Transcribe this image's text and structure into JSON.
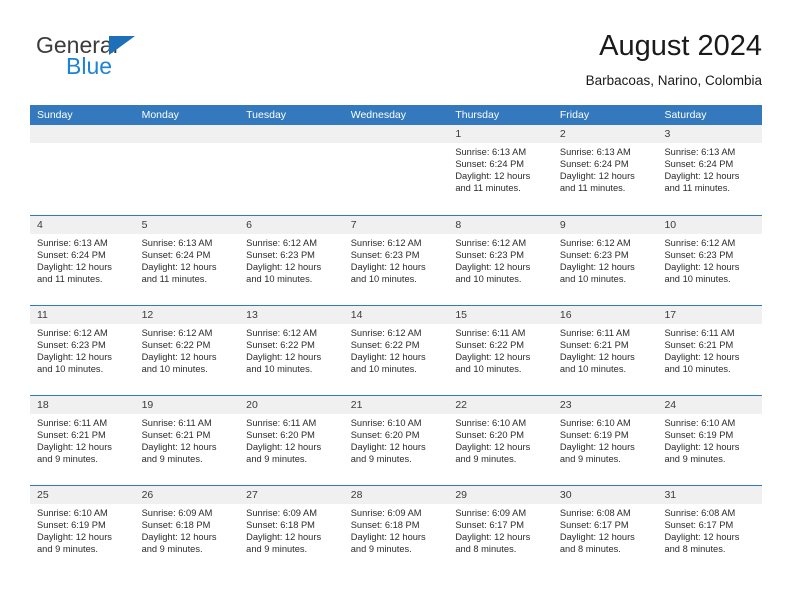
{
  "brand": {
    "name_part1": "General",
    "name_part2": "Blue",
    "triangle_icon": "triangle-icon",
    "colors": {
      "dark": "#3b3b3b",
      "blue": "#1d83d4",
      "triangle": "#1d6fb8"
    }
  },
  "header": {
    "title": "August 2024",
    "subtitle": "Barbacoas, Narino, Colombia"
  },
  "calendar": {
    "header_bg": "#3479bd",
    "header_text": "#ffffff",
    "band_bg": "#f0f0f0",
    "weekdays": [
      "Sunday",
      "Monday",
      "Tuesday",
      "Wednesday",
      "Thursday",
      "Friday",
      "Saturday"
    ],
    "weeks": [
      [
        {
          "day": "",
          "sunrise": "",
          "sunset": "",
          "daylight1": "",
          "daylight2": ""
        },
        {
          "day": "",
          "sunrise": "",
          "sunset": "",
          "daylight1": "",
          "daylight2": ""
        },
        {
          "day": "",
          "sunrise": "",
          "sunset": "",
          "daylight1": "",
          "daylight2": ""
        },
        {
          "day": "",
          "sunrise": "",
          "sunset": "",
          "daylight1": "",
          "daylight2": ""
        },
        {
          "day": "1",
          "sunrise": "Sunrise: 6:13 AM",
          "sunset": "Sunset: 6:24 PM",
          "daylight1": "Daylight: 12 hours",
          "daylight2": "and 11 minutes."
        },
        {
          "day": "2",
          "sunrise": "Sunrise: 6:13 AM",
          "sunset": "Sunset: 6:24 PM",
          "daylight1": "Daylight: 12 hours",
          "daylight2": "and 11 minutes."
        },
        {
          "day": "3",
          "sunrise": "Sunrise: 6:13 AM",
          "sunset": "Sunset: 6:24 PM",
          "daylight1": "Daylight: 12 hours",
          "daylight2": "and 11 minutes."
        }
      ],
      [
        {
          "day": "4",
          "sunrise": "Sunrise: 6:13 AM",
          "sunset": "Sunset: 6:24 PM",
          "daylight1": "Daylight: 12 hours",
          "daylight2": "and 11 minutes."
        },
        {
          "day": "5",
          "sunrise": "Sunrise: 6:13 AM",
          "sunset": "Sunset: 6:24 PM",
          "daylight1": "Daylight: 12 hours",
          "daylight2": "and 11 minutes."
        },
        {
          "day": "6",
          "sunrise": "Sunrise: 6:12 AM",
          "sunset": "Sunset: 6:23 PM",
          "daylight1": "Daylight: 12 hours",
          "daylight2": "and 10 minutes."
        },
        {
          "day": "7",
          "sunrise": "Sunrise: 6:12 AM",
          "sunset": "Sunset: 6:23 PM",
          "daylight1": "Daylight: 12 hours",
          "daylight2": "and 10 minutes."
        },
        {
          "day": "8",
          "sunrise": "Sunrise: 6:12 AM",
          "sunset": "Sunset: 6:23 PM",
          "daylight1": "Daylight: 12 hours",
          "daylight2": "and 10 minutes."
        },
        {
          "day": "9",
          "sunrise": "Sunrise: 6:12 AM",
          "sunset": "Sunset: 6:23 PM",
          "daylight1": "Daylight: 12 hours",
          "daylight2": "and 10 minutes."
        },
        {
          "day": "10",
          "sunrise": "Sunrise: 6:12 AM",
          "sunset": "Sunset: 6:23 PM",
          "daylight1": "Daylight: 12 hours",
          "daylight2": "and 10 minutes."
        }
      ],
      [
        {
          "day": "11",
          "sunrise": "Sunrise: 6:12 AM",
          "sunset": "Sunset: 6:23 PM",
          "daylight1": "Daylight: 12 hours",
          "daylight2": "and 10 minutes."
        },
        {
          "day": "12",
          "sunrise": "Sunrise: 6:12 AM",
          "sunset": "Sunset: 6:22 PM",
          "daylight1": "Daylight: 12 hours",
          "daylight2": "and 10 minutes."
        },
        {
          "day": "13",
          "sunrise": "Sunrise: 6:12 AM",
          "sunset": "Sunset: 6:22 PM",
          "daylight1": "Daylight: 12 hours",
          "daylight2": "and 10 minutes."
        },
        {
          "day": "14",
          "sunrise": "Sunrise: 6:12 AM",
          "sunset": "Sunset: 6:22 PM",
          "daylight1": "Daylight: 12 hours",
          "daylight2": "and 10 minutes."
        },
        {
          "day": "15",
          "sunrise": "Sunrise: 6:11 AM",
          "sunset": "Sunset: 6:22 PM",
          "daylight1": "Daylight: 12 hours",
          "daylight2": "and 10 minutes."
        },
        {
          "day": "16",
          "sunrise": "Sunrise: 6:11 AM",
          "sunset": "Sunset: 6:21 PM",
          "daylight1": "Daylight: 12 hours",
          "daylight2": "and 10 minutes."
        },
        {
          "day": "17",
          "sunrise": "Sunrise: 6:11 AM",
          "sunset": "Sunset: 6:21 PM",
          "daylight1": "Daylight: 12 hours",
          "daylight2": "and 10 minutes."
        }
      ],
      [
        {
          "day": "18",
          "sunrise": "Sunrise: 6:11 AM",
          "sunset": "Sunset: 6:21 PM",
          "daylight1": "Daylight: 12 hours",
          "daylight2": "and 9 minutes."
        },
        {
          "day": "19",
          "sunrise": "Sunrise: 6:11 AM",
          "sunset": "Sunset: 6:21 PM",
          "daylight1": "Daylight: 12 hours",
          "daylight2": "and 9 minutes."
        },
        {
          "day": "20",
          "sunrise": "Sunrise: 6:11 AM",
          "sunset": "Sunset: 6:20 PM",
          "daylight1": "Daylight: 12 hours",
          "daylight2": "and 9 minutes."
        },
        {
          "day": "21",
          "sunrise": "Sunrise: 6:10 AM",
          "sunset": "Sunset: 6:20 PM",
          "daylight1": "Daylight: 12 hours",
          "daylight2": "and 9 minutes."
        },
        {
          "day": "22",
          "sunrise": "Sunrise: 6:10 AM",
          "sunset": "Sunset: 6:20 PM",
          "daylight1": "Daylight: 12 hours",
          "daylight2": "and 9 minutes."
        },
        {
          "day": "23",
          "sunrise": "Sunrise: 6:10 AM",
          "sunset": "Sunset: 6:19 PM",
          "daylight1": "Daylight: 12 hours",
          "daylight2": "and 9 minutes."
        },
        {
          "day": "24",
          "sunrise": "Sunrise: 6:10 AM",
          "sunset": "Sunset: 6:19 PM",
          "daylight1": "Daylight: 12 hours",
          "daylight2": "and 9 minutes."
        }
      ],
      [
        {
          "day": "25",
          "sunrise": "Sunrise: 6:10 AM",
          "sunset": "Sunset: 6:19 PM",
          "daylight1": "Daylight: 12 hours",
          "daylight2": "and 9 minutes."
        },
        {
          "day": "26",
          "sunrise": "Sunrise: 6:09 AM",
          "sunset": "Sunset: 6:18 PM",
          "daylight1": "Daylight: 12 hours",
          "daylight2": "and 9 minutes."
        },
        {
          "day": "27",
          "sunrise": "Sunrise: 6:09 AM",
          "sunset": "Sunset: 6:18 PM",
          "daylight1": "Daylight: 12 hours",
          "daylight2": "and 9 minutes."
        },
        {
          "day": "28",
          "sunrise": "Sunrise: 6:09 AM",
          "sunset": "Sunset: 6:18 PM",
          "daylight1": "Daylight: 12 hours",
          "daylight2": "and 9 minutes."
        },
        {
          "day": "29",
          "sunrise": "Sunrise: 6:09 AM",
          "sunset": "Sunset: 6:17 PM",
          "daylight1": "Daylight: 12 hours",
          "daylight2": "and 8 minutes."
        },
        {
          "day": "30",
          "sunrise": "Sunrise: 6:08 AM",
          "sunset": "Sunset: 6:17 PM",
          "daylight1": "Daylight: 12 hours",
          "daylight2": "and 8 minutes."
        },
        {
          "day": "31",
          "sunrise": "Sunrise: 6:08 AM",
          "sunset": "Sunset: 6:17 PM",
          "daylight1": "Daylight: 12 hours",
          "daylight2": "and 8 minutes."
        }
      ]
    ]
  }
}
